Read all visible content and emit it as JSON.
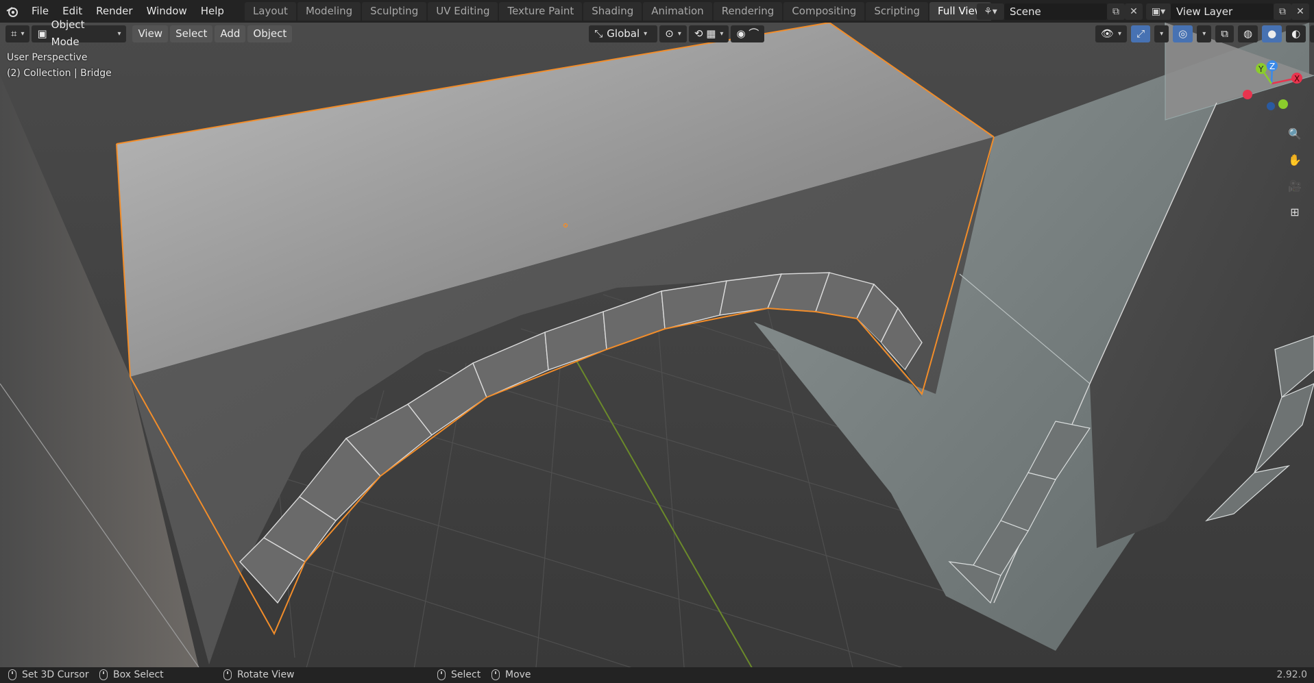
{
  "app": {
    "menus": [
      "File",
      "Edit",
      "Render",
      "Window",
      "Help"
    ],
    "workspaces": [
      "Layout",
      "Modeling",
      "Sculpting",
      "UV Editing",
      "Texture Paint",
      "Shading",
      "Animation",
      "Rendering",
      "Compositing",
      "Scripting",
      "Full View"
    ],
    "active_workspace": "Full View",
    "scene_name": "Scene",
    "view_layer": "View Layer"
  },
  "viewport_header": {
    "mode": "Object Mode",
    "menus": [
      "View",
      "Select",
      "Add",
      "Object"
    ],
    "transform_orientation": "Global"
  },
  "overlay": {
    "perspective": "User Perspective",
    "collection": "(2) Collection | Bridge"
  },
  "gizmo": {
    "axes": [
      "X",
      "Y",
      "Z"
    ],
    "colors": {
      "x": "#e8344e",
      "y": "#8bcc2c",
      "z": "#3b8ae8"
    }
  },
  "statusbar": {
    "items": [
      "Set 3D Cursor",
      "Box Select",
      "Rotate View",
      "Select",
      "Move"
    ],
    "version": "2.92.0"
  },
  "colors": {
    "selection": "#f28d2a",
    "background": "#3d3d3d"
  }
}
